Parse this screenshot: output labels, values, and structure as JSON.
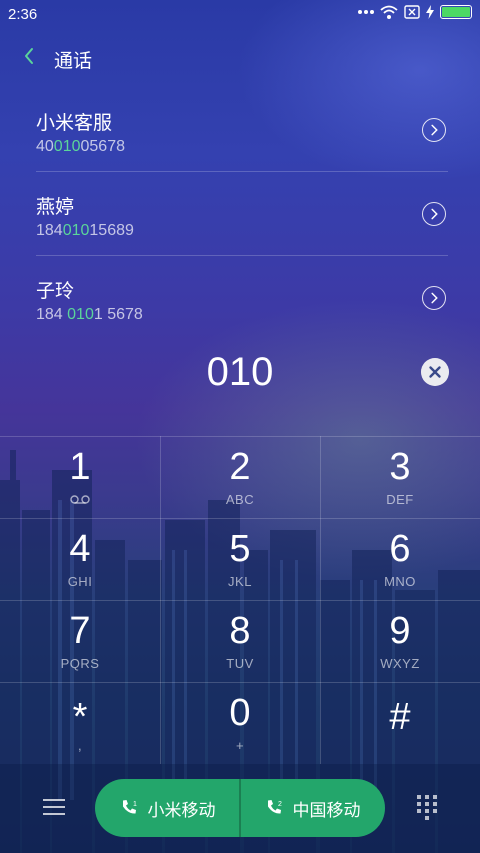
{
  "status_bar": {
    "time": "2:36",
    "icons": [
      "more-dots-icon",
      "wifi-icon",
      "sim-blocked-icon",
      "charging-bolt-icon",
      "battery-icon"
    ],
    "battery_color": "#4cd964"
  },
  "header": {
    "title": "通话",
    "back_icon": "back-chevron-icon"
  },
  "contacts": [
    {
      "name": "小米客服",
      "number_pre": "40",
      "number_match": "010",
      "number_post": "05678"
    },
    {
      "name": "燕婷",
      "number_pre": "184",
      "number_match": "010",
      "number_post": "15689"
    },
    {
      "name": "子玲",
      "number_pre": "184 ",
      "number_match": "010",
      "number_post": "1 5678"
    }
  ],
  "match_color": "#5bd49a",
  "dialed": {
    "digits": "010",
    "clear_icon": "clear-x-icon"
  },
  "keypad": {
    "keys": [
      {
        "num": "1",
        "sub": "voicemail-icon"
      },
      {
        "num": "2",
        "sub": "ABC"
      },
      {
        "num": "3",
        "sub": "DEF"
      },
      {
        "num": "4",
        "sub": "GHI"
      },
      {
        "num": "5",
        "sub": "JKL"
      },
      {
        "num": "6",
        "sub": "MNO"
      },
      {
        "num": "7",
        "sub": "PQRS"
      },
      {
        "num": "8",
        "sub": "TUV"
      },
      {
        "num": "9",
        "sub": "WXYZ"
      },
      {
        "num": "*",
        "sub": ","
      },
      {
        "num": "0",
        "sub": "+"
      },
      {
        "num": "#",
        "sub": ""
      }
    ]
  },
  "bottom_bar": {
    "call_sim1_label": "小米移动",
    "call_sim2_label": "中国移动",
    "call_button_color": "#23a66b",
    "menu_icon": "menu-lines-icon",
    "dialpad_icon": "dialpad-grid-icon"
  }
}
